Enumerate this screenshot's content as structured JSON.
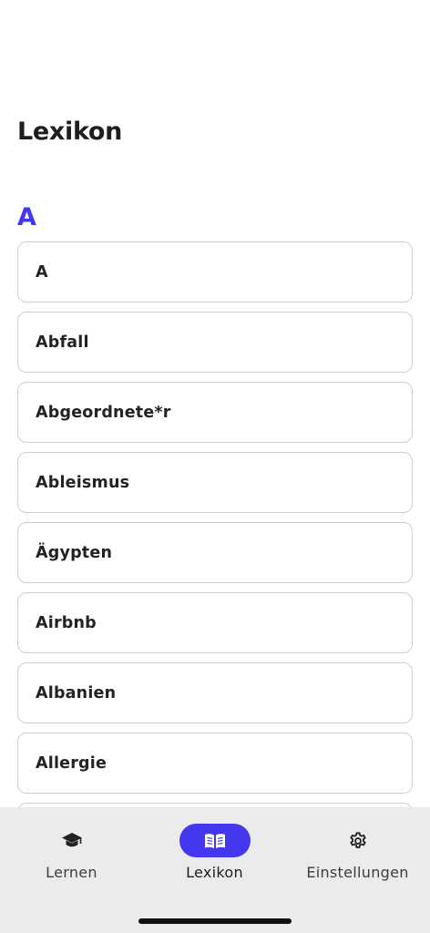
{
  "page": {
    "title": "Lexikon"
  },
  "section": {
    "letter": "A",
    "entries": [
      "A",
      "Abfall",
      "Abgeordnete*r",
      "Ableismus",
      "Ägypten",
      "Airbnb",
      "Albanien",
      "Allergie",
      ""
    ]
  },
  "tabs": [
    {
      "label": "Lernen",
      "icon": "graduation-cap-icon",
      "active": false
    },
    {
      "label": "Lexikon",
      "icon": "open-book-icon",
      "active": true
    },
    {
      "label": "Einstellungen",
      "icon": "gear-icon",
      "active": false
    }
  ],
  "colors": {
    "accent": "#4537f0",
    "tabbar_background": "#ebeaed",
    "card_border": "#cfcfcf",
    "text": "#1e1e1e"
  }
}
